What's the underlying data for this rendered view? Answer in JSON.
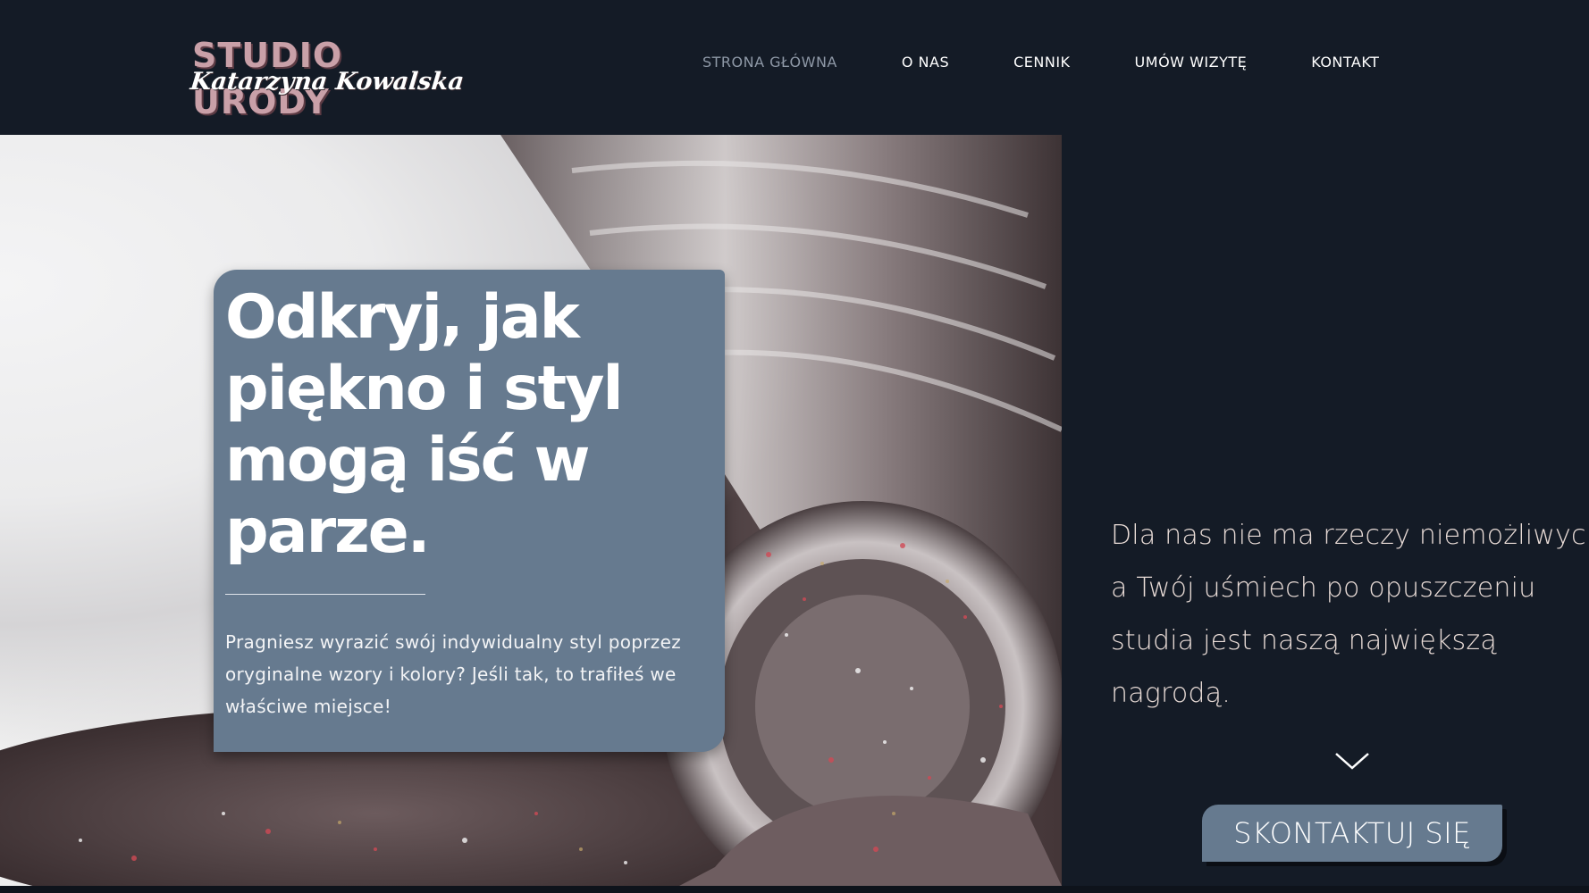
{
  "brand": {
    "title": "STUDIO URODY",
    "subtitle": "Katarzyna Kowalska"
  },
  "nav": {
    "items": [
      {
        "label": "STRONA GŁÓWNA",
        "active": true
      },
      {
        "label": "O NAS",
        "active": false
      },
      {
        "label": "CENNIK",
        "active": false
      },
      {
        "label": "UMÓW WIZYTĘ",
        "active": false
      },
      {
        "label": "KONTAKT",
        "active": false
      }
    ]
  },
  "hero": {
    "heading": "Odkryj, jak piękno i styl mogą iść w parze.",
    "text": "Pragniesz wyrazić swój indywidualny styl poprzez oryginalne wzory i kolory? Jeśli tak, to trafiłeś we właściwe miejsce!",
    "image": "glitter-nail-polish-bottle"
  },
  "aside": {
    "quote_lines": [
      "Dla nas nie ma rzeczy niemożliwych,",
      "a Twój uśmiech po opuszczeniu",
      "studia jest naszą największą",
      "nagrodą."
    ],
    "scroll_icon": "chevron-down-icon",
    "button_label": "SKONTAKTUJ SIĘ"
  },
  "colors": {
    "background": "#141b26",
    "card": "#667a8f",
    "brand_pink": "#c9a0a8",
    "nav_active": "#8e98a6",
    "quote_text": "#e8dbd6"
  }
}
